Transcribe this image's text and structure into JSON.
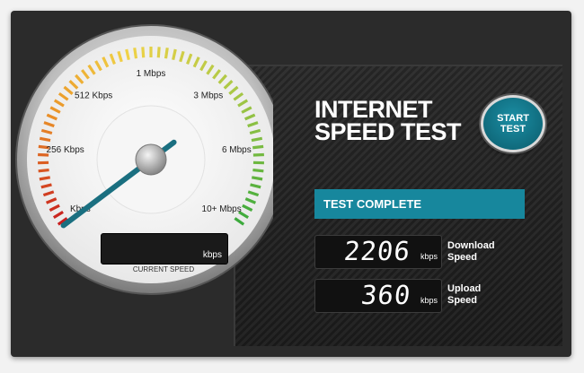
{
  "title": {
    "line1": "INTERNET",
    "line2": "SPEED TEST"
  },
  "start_button": {
    "line1": "START",
    "line2": "TEST"
  },
  "status": "TEST COMPLETE",
  "download": {
    "value": "2206",
    "unit": "kbps",
    "label_line1": "Download",
    "label_line2": "Speed"
  },
  "upload": {
    "value": "360",
    "unit": "kbps",
    "label_line1": "Upload",
    "label_line2": "Speed"
  },
  "gauge": {
    "tick_labels": [
      "Kbps",
      "256 Kbps",
      "512 Kbps",
      "1 Mbps",
      "3 Mbps",
      "6 Mbps",
      "10+ Mbps"
    ],
    "readout_unit": "kbps",
    "caption": "CURRENT SPEED",
    "needle_fraction": 0.0,
    "colors": {
      "accent": "#17879d",
      "needle": "#1a6f80"
    }
  }
}
